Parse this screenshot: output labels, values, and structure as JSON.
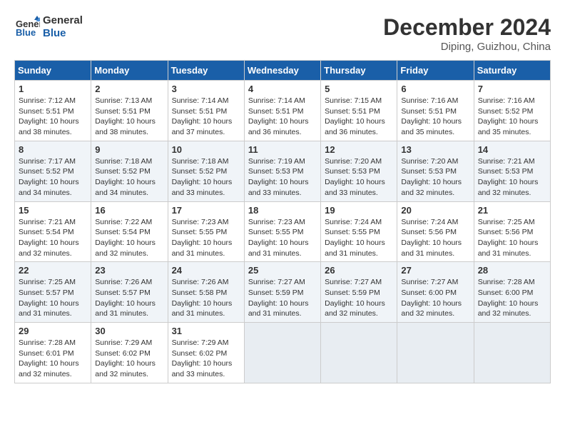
{
  "header": {
    "logo_line1": "General",
    "logo_line2": "Blue",
    "month": "December 2024",
    "location": "Diping, Guizhou, China"
  },
  "weekdays": [
    "Sunday",
    "Monday",
    "Tuesday",
    "Wednesday",
    "Thursday",
    "Friday",
    "Saturday"
  ],
  "weeks": [
    [
      {
        "day": "1",
        "info": "Sunrise: 7:12 AM\nSunset: 5:51 PM\nDaylight: 10 hours\nand 38 minutes."
      },
      {
        "day": "2",
        "info": "Sunrise: 7:13 AM\nSunset: 5:51 PM\nDaylight: 10 hours\nand 38 minutes."
      },
      {
        "day": "3",
        "info": "Sunrise: 7:14 AM\nSunset: 5:51 PM\nDaylight: 10 hours\nand 37 minutes."
      },
      {
        "day": "4",
        "info": "Sunrise: 7:14 AM\nSunset: 5:51 PM\nDaylight: 10 hours\nand 36 minutes."
      },
      {
        "day": "5",
        "info": "Sunrise: 7:15 AM\nSunset: 5:51 PM\nDaylight: 10 hours\nand 36 minutes."
      },
      {
        "day": "6",
        "info": "Sunrise: 7:16 AM\nSunset: 5:51 PM\nDaylight: 10 hours\nand 35 minutes."
      },
      {
        "day": "7",
        "info": "Sunrise: 7:16 AM\nSunset: 5:52 PM\nDaylight: 10 hours\nand 35 minutes."
      }
    ],
    [
      {
        "day": "8",
        "info": "Sunrise: 7:17 AM\nSunset: 5:52 PM\nDaylight: 10 hours\nand 34 minutes."
      },
      {
        "day": "9",
        "info": "Sunrise: 7:18 AM\nSunset: 5:52 PM\nDaylight: 10 hours\nand 34 minutes."
      },
      {
        "day": "10",
        "info": "Sunrise: 7:18 AM\nSunset: 5:52 PM\nDaylight: 10 hours\nand 33 minutes."
      },
      {
        "day": "11",
        "info": "Sunrise: 7:19 AM\nSunset: 5:53 PM\nDaylight: 10 hours\nand 33 minutes."
      },
      {
        "day": "12",
        "info": "Sunrise: 7:20 AM\nSunset: 5:53 PM\nDaylight: 10 hours\nand 33 minutes."
      },
      {
        "day": "13",
        "info": "Sunrise: 7:20 AM\nSunset: 5:53 PM\nDaylight: 10 hours\nand 32 minutes."
      },
      {
        "day": "14",
        "info": "Sunrise: 7:21 AM\nSunset: 5:53 PM\nDaylight: 10 hours\nand 32 minutes."
      }
    ],
    [
      {
        "day": "15",
        "info": "Sunrise: 7:21 AM\nSunset: 5:54 PM\nDaylight: 10 hours\nand 32 minutes."
      },
      {
        "day": "16",
        "info": "Sunrise: 7:22 AM\nSunset: 5:54 PM\nDaylight: 10 hours\nand 32 minutes."
      },
      {
        "day": "17",
        "info": "Sunrise: 7:23 AM\nSunset: 5:55 PM\nDaylight: 10 hours\nand 31 minutes."
      },
      {
        "day": "18",
        "info": "Sunrise: 7:23 AM\nSunset: 5:55 PM\nDaylight: 10 hours\nand 31 minutes."
      },
      {
        "day": "19",
        "info": "Sunrise: 7:24 AM\nSunset: 5:55 PM\nDaylight: 10 hours\nand 31 minutes."
      },
      {
        "day": "20",
        "info": "Sunrise: 7:24 AM\nSunset: 5:56 PM\nDaylight: 10 hours\nand 31 minutes."
      },
      {
        "day": "21",
        "info": "Sunrise: 7:25 AM\nSunset: 5:56 PM\nDaylight: 10 hours\nand 31 minutes."
      }
    ],
    [
      {
        "day": "22",
        "info": "Sunrise: 7:25 AM\nSunset: 5:57 PM\nDaylight: 10 hours\nand 31 minutes."
      },
      {
        "day": "23",
        "info": "Sunrise: 7:26 AM\nSunset: 5:57 PM\nDaylight: 10 hours\nand 31 minutes."
      },
      {
        "day": "24",
        "info": "Sunrise: 7:26 AM\nSunset: 5:58 PM\nDaylight: 10 hours\nand 31 minutes."
      },
      {
        "day": "25",
        "info": "Sunrise: 7:27 AM\nSunset: 5:59 PM\nDaylight: 10 hours\nand 31 minutes."
      },
      {
        "day": "26",
        "info": "Sunrise: 7:27 AM\nSunset: 5:59 PM\nDaylight: 10 hours\nand 32 minutes."
      },
      {
        "day": "27",
        "info": "Sunrise: 7:27 AM\nSunset: 6:00 PM\nDaylight: 10 hours\nand 32 minutes."
      },
      {
        "day": "28",
        "info": "Sunrise: 7:28 AM\nSunset: 6:00 PM\nDaylight: 10 hours\nand 32 minutes."
      }
    ],
    [
      {
        "day": "29",
        "info": "Sunrise: 7:28 AM\nSunset: 6:01 PM\nDaylight: 10 hours\nand 32 minutes."
      },
      {
        "day": "30",
        "info": "Sunrise: 7:29 AM\nSunset: 6:02 PM\nDaylight: 10 hours\nand 32 minutes."
      },
      {
        "day": "31",
        "info": "Sunrise: 7:29 AM\nSunset: 6:02 PM\nDaylight: 10 hours\nand 33 minutes."
      },
      {
        "day": "",
        "info": ""
      },
      {
        "day": "",
        "info": ""
      },
      {
        "day": "",
        "info": ""
      },
      {
        "day": "",
        "info": ""
      }
    ]
  ]
}
